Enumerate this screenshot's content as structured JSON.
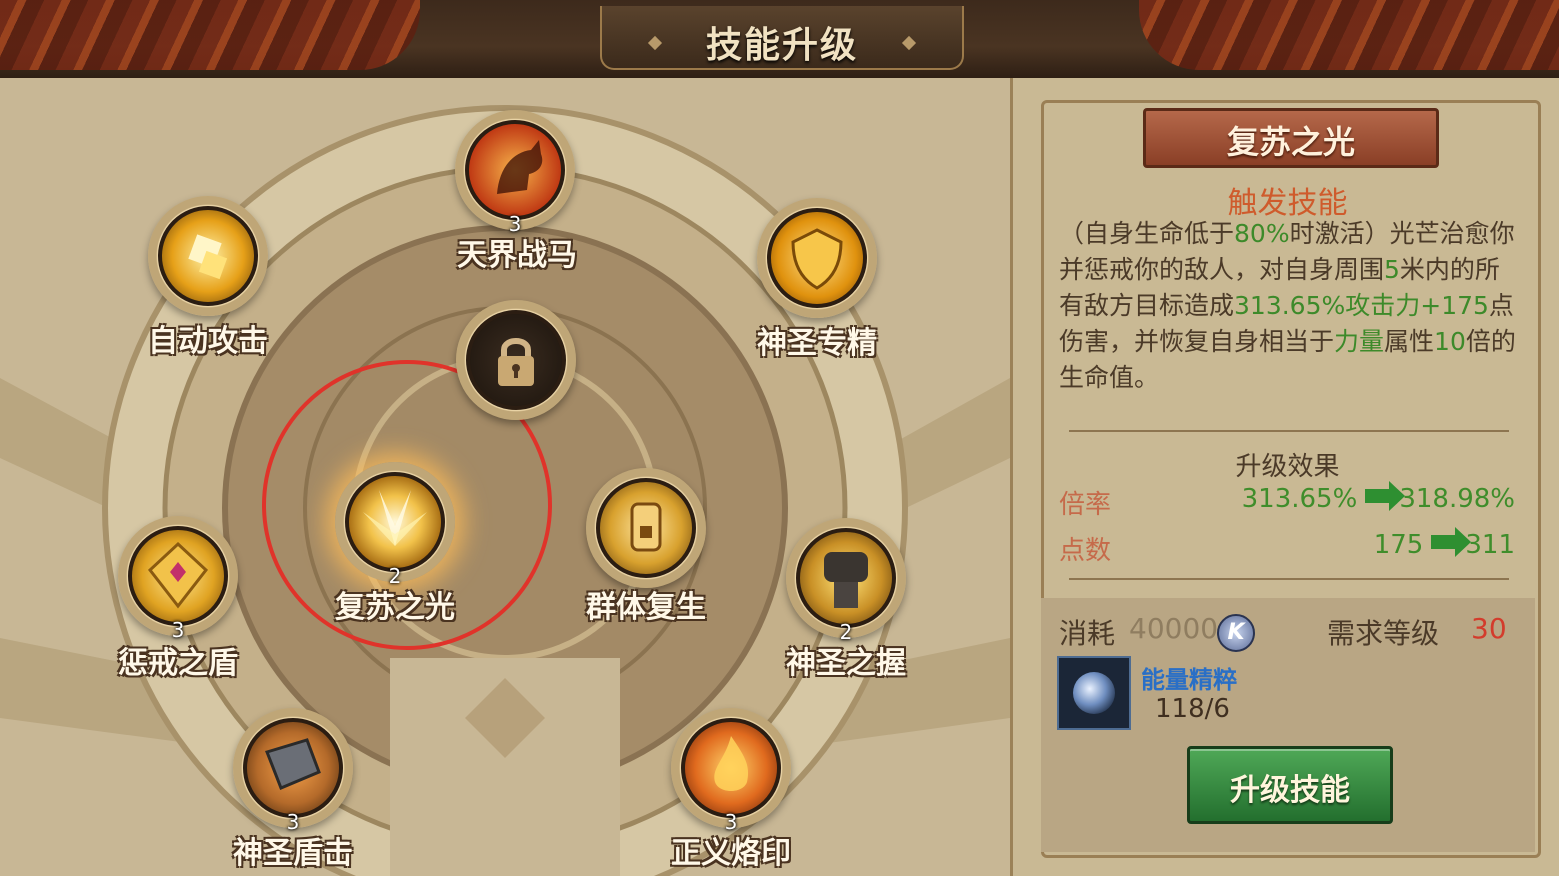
{
  "header": {
    "title": "技能升级"
  },
  "skills": [
    {
      "name": "天界战马",
      "level": "3",
      "icon": "horse-icon",
      "color": "#d9531e"
    },
    {
      "name": "自动攻击",
      "level": "",
      "icon": "golden-cubes-icon",
      "color": "#e0a21a"
    },
    {
      "name": "神圣专精",
      "level": "",
      "icon": "golden-shield-swirl-icon",
      "color": "#e6a41c"
    },
    {
      "name": "",
      "level": "",
      "icon": "lock-icon",
      "color": "#3a2c20"
    },
    {
      "name": "复苏之光",
      "level": "2",
      "icon": "light-burst-icon",
      "color": "#f2c24a"
    },
    {
      "name": "群体复生",
      "level": "",
      "icon": "radiant-hand-icon",
      "color": "#d8a12e"
    },
    {
      "name": "惩戒之盾",
      "level": "3",
      "icon": "gem-shield-icon",
      "color": "#e0a322"
    },
    {
      "name": "神圣之握",
      "level": "2",
      "icon": "gauntlet-icon",
      "color": "#c99026"
    },
    {
      "name": "神圣盾击",
      "level": "3",
      "icon": "shield-bash-icon",
      "color": "#b46a2a"
    },
    {
      "name": "正义烙印",
      "level": "3",
      "icon": "flame-brand-icon",
      "color": "#e06a1e"
    }
  ],
  "detail": {
    "skill_name": "复苏之光",
    "skill_type": "触发技能",
    "desc": [
      {
        "t": "（自身生命低于",
        "g": false
      },
      {
        "t": "80%",
        "g": true
      },
      {
        "t": "时激活）光芒治愈你并惩戒你的敌人，对自身周围",
        "g": false
      },
      {
        "t": "5",
        "g": true
      },
      {
        "t": "米内的所有敌方目标造成",
        "g": false
      },
      {
        "t": "313.65%攻击力+175",
        "g": true
      },
      {
        "t": "点伤害，并恢复自身相当于",
        "g": false
      },
      {
        "t": "力量",
        "g": true
      },
      {
        "t": "属性",
        "g": false
      },
      {
        "t": "10",
        "g": true
      },
      {
        "t": "倍的生命值。",
        "g": false
      }
    ],
    "effects_title": "升级效果",
    "rows": [
      {
        "label": "倍率",
        "from": "313.65%",
        "to": "318.98%"
      },
      {
        "label": "点数",
        "from": "175",
        "to": "311"
      }
    ],
    "cost_label": "消耗",
    "cost_value": "40000",
    "coin_letter": "K",
    "required_level_label": "需求等级",
    "required_level": "30",
    "material_name": "能量精粹",
    "material_count": "118/6",
    "upgrade_button": "升级技能"
  }
}
